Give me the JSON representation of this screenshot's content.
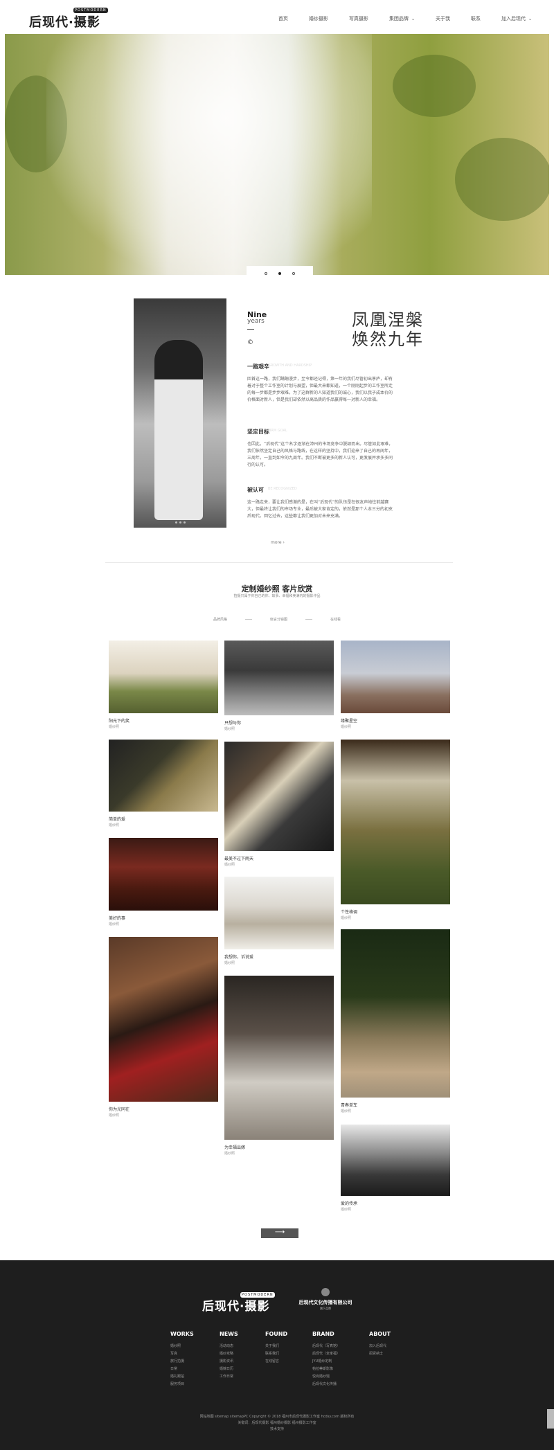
{
  "header": {
    "logo": "后现代·摄影",
    "logo_tag": "POSTMODERN",
    "nav": [
      {
        "label": "首页",
        "chev": ""
      },
      {
        "label": "婚纱摄影",
        "chev": ""
      },
      {
        "label": "写真摄影",
        "chev": ""
      },
      {
        "label": "集团品牌",
        "chev": "⌄"
      },
      {
        "label": "关于我",
        "chev": ""
      },
      {
        "label": "联系",
        "chev": ""
      },
      {
        "label": "加入后现代",
        "chev": "⌄"
      }
    ]
  },
  "hero": {
    "slides": 3,
    "active_slide": 2
  },
  "about": {
    "nine": "Nine",
    "years": "years",
    "mark": "©",
    "title_line1": "凤凰涅槃",
    "title_line2": "焕然九年",
    "sections": [
      {
        "title": "一路艰辛",
        "en": "GROWTH AND HARDSHIP",
        "text": "回首这一路，我们蹒跚漫步，至今都还记得，第一年的我们尽管初出茅庐，却有着对于整个工作室的计划与展望，但最大来都知道，一个刚刚起步的工作室所走的每一步都是步步艰难。为了这群新的人知道我们的诚心，我们以我子成本价的价格面对新人，但是我们却依然以高品质的作品赢得每一对新人的幸福。"
      },
      {
        "title": "坚定目标",
        "en": "FIRM GOAL",
        "text": "也因此，“后现代”这个名字逐渐在漳州的市场竞争中脱颖而出。尽管如此艰难，我们依然坚定自己的风格与路线，在这样的坚持中，我们迎来了自己的再阔年，三周年，一直到如今的九周年。我们不断被更多的新人认可，更发展并承多多同行的认可。"
      },
      {
        "title": "被认可",
        "en": "BE RECOGNIZED",
        "text": "这一路走来，要让我们感谢的是，在叫“后现代”的队伍是在很友声地往前越赛大，但最终让我们的市场专业，最后被大家肯定的，依然是那个人本三分的初支后现代。回忆过去，这些都让我们更加对未来充满。"
      }
    ],
    "more": "more ›"
  },
  "gallery": {
    "title": "定制婚纱照 客片欣赏",
    "subtitle": "拍摄只属于你自己的你、故事、幸福和美满内的摄影作品",
    "tabs": [
      "品牌风格",
      "晓言分镜图",
      "在线看"
    ],
    "items": [
      {
        "caption": "阳光下的笑",
        "category": "婚纱照"
      },
      {
        "caption": "只想与你",
        "category": "婚纱照"
      },
      {
        "caption": "缘聚星空",
        "category": "婚纱照"
      },
      {
        "caption": "简单的爱",
        "category": "婚纱照"
      },
      {
        "caption": "最美不过下雨天",
        "category": "婚纱照"
      },
      {
        "caption": "个性格调",
        "category": "婚纱照"
      },
      {
        "caption": "美好的事",
        "category": "婚纱照"
      },
      {
        "caption": "我想你，诉说爱",
        "category": "婚纱照"
      },
      {
        "caption": "你为光同在",
        "category": "婚纱照"
      },
      {
        "caption": "青春单车",
        "category": "婚纱照"
      },
      {
        "caption": "为幸福出嫁",
        "category": "婚纱照"
      },
      {
        "caption": "爱的传承",
        "category": "婚纱照"
      }
    ],
    "next": "⟶"
  },
  "footer": {
    "logo": "后现代·摄影",
    "logo_tag": "POSTMODERN",
    "company": "后现代文化传播有限公司",
    "company_sub": "旗下品牌",
    "columns": [
      {
        "title": "WORKS",
        "links": [
          "婚纱照",
          "写真",
          "旅行拍摄",
          "日常",
          "婚礼跟拍",
          "服务项目"
        ]
      },
      {
        "title": "NEWS",
        "links": [
          "活动动态",
          "婚纱攻略",
          "摄影资讯",
          "婚嫁日历",
          "工作日常"
        ]
      },
      {
        "title": "FOUND",
        "links": [
          "关于我们",
          "联系我们",
          "在线留言"
        ]
      },
      {
        "title": "BRAND",
        "links": [
          "后现代（写真馆）",
          "后现代（全家福）",
          "JYU婚纱定制",
          "帕拉蒂斯影像",
          "悦尚婚纱馆",
          "后现代文化传播"
        ]
      },
      {
        "title": "ABOUT",
        "links": [
          "加入后现代",
          "招贤纳士"
        ]
      }
    ],
    "copyright_line1": "网站地图  sitemap  sitemapPC  Copyright © 2018 福州市后现代摄影工作室 hcdsy.com 版权所有",
    "copyright_line2": "关键词：后现代摄影 福州婚纱摄影 福州摄影工作室",
    "copyright_line3": "技术支持"
  },
  "colors": {
    "footer_bg": "#1e1e1e",
    "accent": "#555555"
  }
}
